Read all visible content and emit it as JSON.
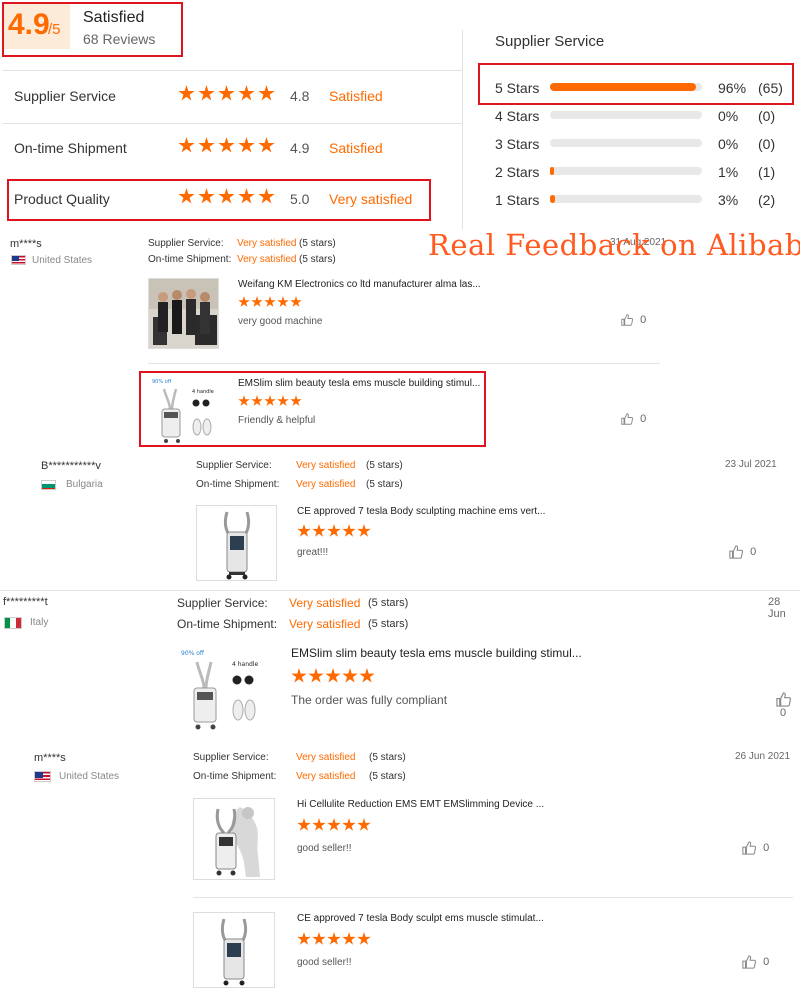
{
  "summary": {
    "score": "4.9",
    "denominator": "/5",
    "label": "Satisfied",
    "reviews": "68 Reviews"
  },
  "ratings": [
    {
      "label": "Supplier Service",
      "value": "4.8",
      "text": "Satisfied"
    },
    {
      "label": "On-time Shipment",
      "value": "4.9",
      "text": "Satisfied"
    },
    {
      "label": "Product Quality",
      "value": "5.0",
      "text": "Very satisfied"
    }
  ],
  "distribution": {
    "title": "Supplier Service",
    "rows": [
      {
        "label": "5  Stars",
        "pct": "96%",
        "count": "(65)",
        "fraction": 0.96
      },
      {
        "label": "4  Stars",
        "pct": "0%",
        "count": "(0)",
        "fraction": 0
      },
      {
        "label": "3  Stars",
        "pct": "0%",
        "count": "(0)",
        "fraction": 0
      },
      {
        "label": "2  Stars",
        "pct": "1%",
        "count": "(1)",
        "fraction": 0.01
      },
      {
        "label": "1  Stars",
        "pct": "3%",
        "count": "(2)",
        "fraction": 0.03
      }
    ]
  },
  "watermark": "Real Feedback on Alibaba",
  "labels": {
    "supplier": "Supplier Service:",
    "shipment": "On-time Shipment:"
  },
  "reviews": [
    {
      "user": "m****s",
      "country": "United States",
      "date": "31 Aug 2021",
      "supplier_rating": "Very satisfied",
      "supplier_stars": "(5 stars)",
      "shipment_rating": "Very satisfied",
      "shipment_stars": "(5 stars)",
      "products": [
        {
          "title": "Weifang KM Electronics co ltd manufacturer alma las...",
          "comment": "very good machine",
          "likes": "0"
        },
        {
          "title": "EMSlim slim beauty tesla ems muscle building stimul...",
          "comment": "Friendly & helpful",
          "likes": "0"
        }
      ]
    },
    {
      "user": "B***********v",
      "country": "Bulgaria",
      "date": "23 Jul 2021",
      "supplier_rating": "Very satisfied",
      "supplier_stars": "(5 stars)",
      "shipment_rating": "Very satisfied",
      "shipment_stars": "(5 stars)",
      "products": [
        {
          "title": "CE approved 7 tesla Body sculpting machine ems vert...",
          "comment": "great!!!",
          "likes": "0"
        }
      ]
    },
    {
      "user": "f*********t",
      "country": "Italy",
      "date": "28 Jun",
      "supplier_rating": "Very satisfied",
      "supplier_stars": "(5 stars)",
      "shipment_rating": "Very satisfied",
      "shipment_stars": "(5 stars)",
      "products": [
        {
          "title": "EMSlim slim beauty tesla ems muscle building stimul...",
          "comment": "The order was fully compliant",
          "likes": "0"
        }
      ]
    },
    {
      "user": "m****s",
      "country": "United States",
      "date": "26 Jun 2021",
      "supplier_rating": "Very satisfied",
      "supplier_stars": "(5 stars)",
      "shipment_rating": "Very satisfied",
      "shipment_stars": "(5 stars)",
      "products": [
        {
          "title": "Hi Cellulite Reduction EMS EMT EMSlimming Device ...",
          "comment": "good seller!!",
          "likes": "0"
        },
        {
          "title": "CE approved 7 tesla Body sculpt ems muscle stimulat...",
          "comment": "good seller!!",
          "likes": "0"
        }
      ]
    }
  ],
  "product_image_badges": {
    "discount": "90% off",
    "handle": "4 handle"
  },
  "colors": {
    "accent": "#ff6a00",
    "highlight_box": "#e0141e"
  }
}
